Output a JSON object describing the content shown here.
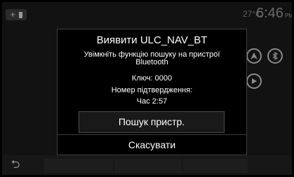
{
  "status": {
    "add_device_label": "+",
    "temperature": "27°C",
    "time": "6:46",
    "ampm": "PM"
  },
  "icons": [
    "phone-icon",
    "navigation-icon",
    "bluetooth-icon",
    "media-play-icon",
    "back-arrow-icon"
  ],
  "dialog": {
    "title": "Виявити ULC_NAV_BT",
    "message_line1": "Увімкніть функцію пошуку на пристрої",
    "message_line2": "Bluetooth",
    "key_label": "Ключ: 0000",
    "confirm_label": "Номер підтвердження:",
    "time_label": "Час 2:57",
    "search_button": "Пошук пристр.",
    "cancel_button": "Скасувати"
  },
  "colors": {
    "background": "#121212",
    "dialog_bg": "#000000",
    "border": "#3e3e3e",
    "text": "#ffffff",
    "muted": "#8a8a8a"
  }
}
